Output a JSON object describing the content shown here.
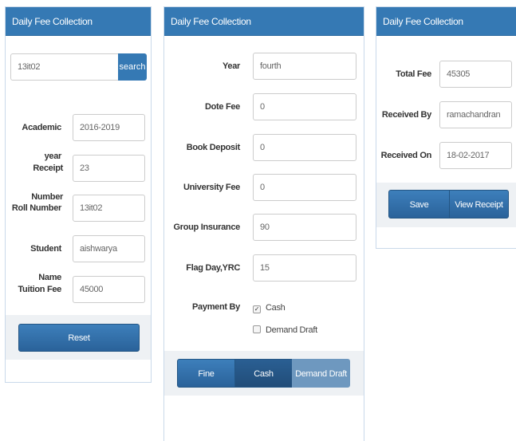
{
  "panel1": {
    "title": "Daily Fee Collection",
    "search_value": "13it02",
    "search_button": "search",
    "fields": [
      {
        "label": "Academic year",
        "value": "2016-2019"
      },
      {
        "label": "Receipt Number",
        "value": "23"
      },
      {
        "label": "Roll Number",
        "value": "13it02"
      },
      {
        "label": "Student Name",
        "value": "aishwarya"
      },
      {
        "label": "Tuition Fee",
        "value": "45000"
      }
    ],
    "reset_button": "Reset"
  },
  "panel2": {
    "title": "Daily Fee Collection",
    "fields": [
      {
        "label": "Year",
        "value": "fourth"
      },
      {
        "label": "Dote Fee",
        "value": "0"
      },
      {
        "label": "Book Deposit",
        "value": "0"
      },
      {
        "label": "University Fee",
        "value": "0"
      },
      {
        "label": "Group Insurance",
        "value": "90"
      },
      {
        "label": "Flag Day,YRC",
        "value": "15"
      }
    ],
    "payment_label": "Payment By",
    "payment_options": [
      {
        "label": "Cash",
        "checked": true
      },
      {
        "label": "Demand Draft",
        "checked": false
      }
    ],
    "tabs": [
      "Fine",
      "Cash",
      "Demand Draft"
    ]
  },
  "panel3": {
    "title": "Daily Fee Collection",
    "fields": [
      {
        "label": "Total Fee",
        "value": "45305"
      },
      {
        "label": "Received By",
        "value": "ramachandran"
      },
      {
        "label": "Received On",
        "value": "18-02-2017"
      }
    ],
    "save_button": "Save",
    "view_receipt_button": "View Receipt"
  },
  "colors": {
    "header": "#3579b4",
    "button": "#2d6aa5",
    "button_light": "#6e98bf"
  }
}
